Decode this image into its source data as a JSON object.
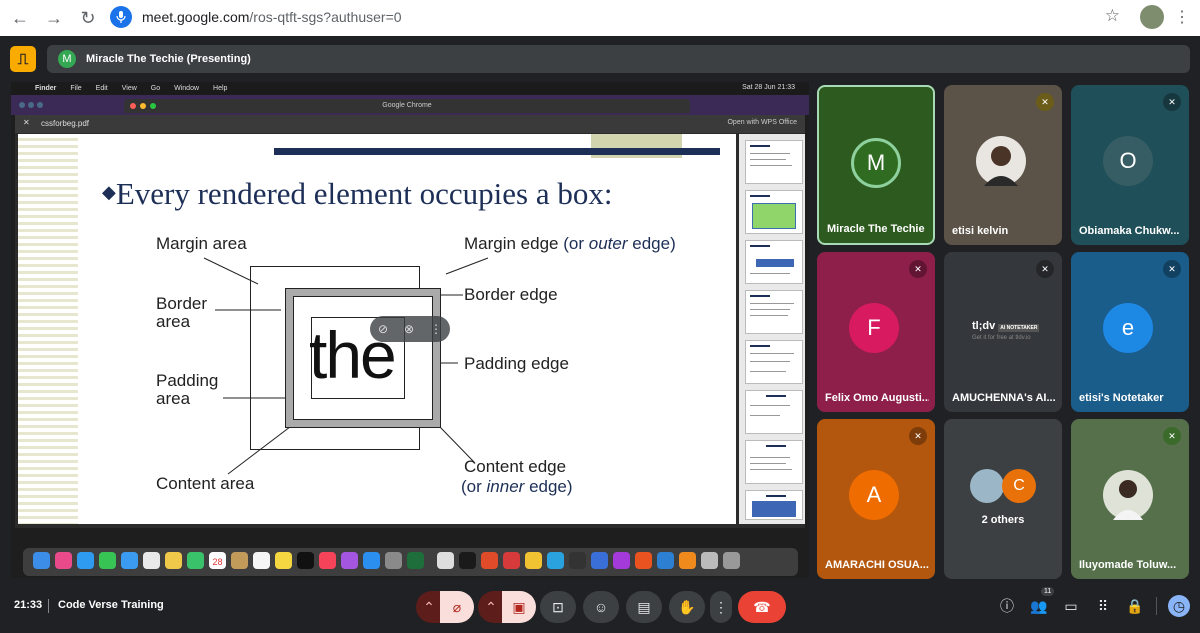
{
  "browser": {
    "url_host": "meet.google.com",
    "url_path": "/ros-qtft-sgs?authuser=0"
  },
  "meet": {
    "presenter_avatar": "M",
    "presenter_text": "Miracle The Techie (Presenting)"
  },
  "shared_screen": {
    "mac_menu": [
      "Finder",
      "File",
      "Edit",
      "View",
      "Go",
      "Window",
      "Help"
    ],
    "mac_datetime": "Sat 28 Jun  21:33",
    "chrome_title": "Google Chrome",
    "pdf_tab": "cssforbeg.pdf",
    "open_with": "Open with WPS Office",
    "slide": {
      "title": "Every rendered element occupies a box:",
      "margin_area": "Margin area",
      "margin_edge": "Margin edge",
      "margin_edge_or": "(or",
      "margin_edge_outer": "outer",
      "margin_edge_end": "edge)",
      "border_area_1": "Border",
      "border_area_2": "area",
      "border_edge": "Border edge",
      "padding_area_1": "Padding",
      "padding_area_2": "area",
      "padding_edge": "Padding edge",
      "content_area": "Content area",
      "content_edge": "Content edge",
      "content_edge_or": "(or",
      "content_edge_inner": "inner",
      "content_edge_end": "edge)",
      "box_word": "the"
    },
    "dock_date": "28"
  },
  "participants": [
    {
      "name": "Miracle The Techie",
      "initial": "M",
      "color": "#2d5a1e",
      "avatar_color": "#2f6b20",
      "muted": false
    },
    {
      "name": "etisi kelvin",
      "initial": "",
      "color": "#5b5248",
      "avatar_color": "#e9e6e1",
      "muted": true
    },
    {
      "name": "Obiamaka Chukw...",
      "initial": "O",
      "color": "#1f4f58",
      "avatar_color": "#355d63",
      "muted": true
    },
    {
      "name": "Felix Omo Augusti...",
      "initial": "F",
      "color": "#8d1f4a",
      "avatar_color": "#d81b60",
      "muted": true
    },
    {
      "name": "AMUCHENNA's AI...",
      "initial": "",
      "color": "#34373b",
      "avatar_color": "#34373b",
      "muted": true
    },
    {
      "name": "etisi's Notetaker",
      "initial": "e",
      "color": "#1a5c8a",
      "avatar_color": "#1e88e5",
      "muted": true
    },
    {
      "name": "AMARACHI OSUA...",
      "initial": "A",
      "color": "#b3560e",
      "avatar_color": "#ef6c00",
      "muted": true
    },
    {
      "name": "2 others",
      "initial": "C",
      "color": "#3c4043",
      "avatar_color": "#e8710a",
      "muted": false
    },
    {
      "name": "Iluyomade Toluw...",
      "initial": "",
      "color": "#55704a",
      "avatar_color": "#dfe3d7",
      "muted": true
    }
  ],
  "notetaker": {
    "brand": "tl;dv",
    "tag": "AI NOTETAKER",
    "sub": "Get it for free at tldv.io"
  },
  "bottom": {
    "clock": "21:33",
    "meeting_name": "Code Verse Training",
    "people_count": "11"
  }
}
